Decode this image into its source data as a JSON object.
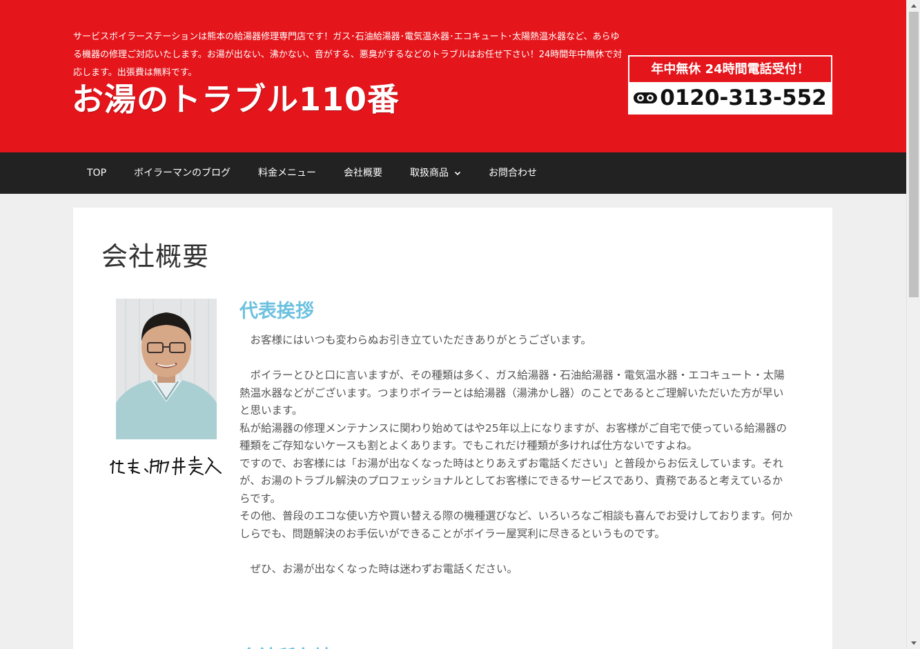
{
  "header": {
    "tagline": "サービスボイラーステーションは熊本の給湯器修理専門店です！ガス･石油給湯器･電気温水器･エコキュート･太陽熱温水器など、あらゆる機器の修理ご対応いたします。お湯が出ない、沸かない、音がする、悪臭がするなどのトラブルはお任せ下さい！24時間年中無休で対応します。出張費は無料です。",
    "site_title": "お湯のトラブル110番",
    "phone_banner": "年中無休 24時間電話受付！",
    "phone_number": "0120-313-552",
    "freedial_icon": "freedial-icon"
  },
  "nav": {
    "items": [
      {
        "label": "TOP"
      },
      {
        "label": "ボイラーマンのブログ"
      },
      {
        "label": "料金メニュー"
      },
      {
        "label": "会社概要"
      },
      {
        "label": "取扱商品",
        "has_dropdown": true
      },
      {
        "label": "お問合わせ"
      }
    ]
  },
  "main": {
    "page_title": "会社概要",
    "greeting_title": "代表挨拶",
    "signature": "代表 駒井義久",
    "paragraphs": [
      "　お客様にはいつも変わらぬお引き立ていただきありがとうございます。",
      "　ボイラーとひと口に言いますが、その種類は多く、ガス給湯器・石油給湯器・電気温水器・エコキュート・太陽熱温水器などがございます。つまりボイラーとは給湯器（湯沸かし器）のことであるとご理解いただいた方が早いと思います。",
      "私が給湯器の修理メンテナンスに関わり始めてはや25年以上になりますが、お客様がご自宅で使っている給湯器の種類をご存知ないケースも割とよくあります。でもこれだけ種類が多ければ仕方ないですよね。",
      "ですので、お客様には「お湯が出なくなった時はとりあえずお電話ください」と普段からお伝えしています。それが、お湯のトラブル解決のプロフェッショナルとしてお客様にできるサービスであり、責務であると考えているからです。",
      "その他、普段のエコな使い方や買い替える際の機種選びなど、いろいろなご相談も喜んでお受けしております。何かしらでも、問題解決のお手伝いができることがボイラー屋冥利に尽きるというものです。",
      "　ぜひ、お湯が出なくなった時は迷わずお電話ください。"
    ],
    "next_section_title": "会社所在地"
  },
  "colors": {
    "header_red": "#e4151b",
    "nav_dark": "#222222",
    "heading_blue": "#6cc1df",
    "body_text": "#555555"
  }
}
